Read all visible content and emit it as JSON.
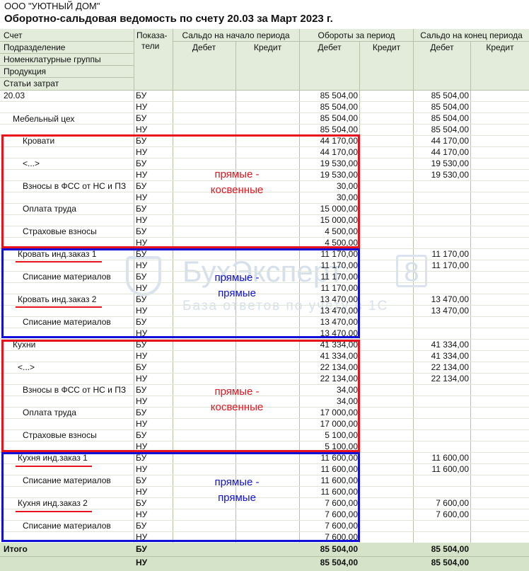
{
  "doc": {
    "org": "ООО \"УЮТНЫЙ ДОМ\"",
    "title": "Оборотно-сальдовая ведомость по счету 20.03 за Март 2023 г."
  },
  "header": {
    "dims": [
      "Счет",
      "Подразделение",
      "Номенклатурные группы",
      "Продукция",
      "Статьи затрат"
    ],
    "indicator_l1": "Показа-",
    "indicator_l2": "тели",
    "groups": [
      "Сальдо на начало периода",
      "Обороты за период",
      "Сальдо на конец периода"
    ],
    "debit": "Дебет",
    "credit": "Кредит"
  },
  "rows": [
    {
      "name": "20.03",
      "ind": "БУ",
      "turn_d": "85 504,00",
      "end_d": "85 504,00"
    },
    {
      "name": "",
      "ind": "НУ",
      "turn_d": "85 504,00",
      "end_d": "85 504,00"
    },
    {
      "name": "Мебельный цех",
      "ind": "БУ",
      "turn_d": "85 504,00",
      "end_d": "85 504,00"
    },
    {
      "name": "",
      "ind": "НУ",
      "turn_d": "85 504,00",
      "end_d": "85 504,00"
    },
    {
      "name": "Кровати",
      "ind": "БУ",
      "turn_d": "44 170,00",
      "end_d": "44 170,00"
    },
    {
      "name": "",
      "ind": "НУ",
      "turn_d": "44 170,00",
      "end_d": "44 170,00"
    },
    {
      "name": "<...>",
      "ind": "БУ",
      "turn_d": "19 530,00",
      "end_d": "19 530,00"
    },
    {
      "name": "",
      "ind": "НУ",
      "turn_d": "19 530,00",
      "end_d": "19 530,00"
    },
    {
      "name": "Взносы в ФСС от НС и ПЗ",
      "ind": "БУ",
      "turn_d": "30,00",
      "end_d": ""
    },
    {
      "name": "",
      "ind": "НУ",
      "turn_d": "30,00",
      "end_d": ""
    },
    {
      "name": "Оплата труда",
      "ind": "БУ",
      "turn_d": "15 000,00",
      "end_d": ""
    },
    {
      "name": "",
      "ind": "НУ",
      "turn_d": "15 000,00",
      "end_d": ""
    },
    {
      "name": "Страховые взносы",
      "ind": "БУ",
      "turn_d": "4 500,00",
      "end_d": ""
    },
    {
      "name": "",
      "ind": "НУ",
      "turn_d": "4 500,00",
      "end_d": ""
    },
    {
      "name": "Кровать инд.заказ 1",
      "ind": "БУ",
      "turn_d": "11 170,00",
      "end_d": "11 170,00"
    },
    {
      "name": "",
      "ind": "НУ",
      "turn_d": "11 170,00",
      "end_d": "11 170,00"
    },
    {
      "name": "Списание материалов",
      "ind": "БУ",
      "turn_d": "11 170,00",
      "end_d": ""
    },
    {
      "name": "",
      "ind": "НУ",
      "turn_d": "11 170,00",
      "end_d": ""
    },
    {
      "name": "Кровать инд.заказ 2",
      "ind": "БУ",
      "turn_d": "13 470,00",
      "end_d": "13 470,00"
    },
    {
      "name": "",
      "ind": "НУ",
      "turn_d": "13 470,00",
      "end_d": "13 470,00"
    },
    {
      "name": "Списание материалов",
      "ind": "БУ",
      "turn_d": "13 470,00",
      "end_d": ""
    },
    {
      "name": "",
      "ind": "НУ",
      "turn_d": "13 470,00",
      "end_d": ""
    },
    {
      "name": "Кухни",
      "ind": "БУ",
      "turn_d": "41 334,00",
      "end_d": "41 334,00"
    },
    {
      "name": "",
      "ind": "НУ",
      "turn_d": "41 334,00",
      "end_d": "41 334,00"
    },
    {
      "name": "<...>",
      "ind": "БУ",
      "turn_d": "22 134,00",
      "end_d": "22 134,00"
    },
    {
      "name": "",
      "ind": "НУ",
      "turn_d": "22 134,00",
      "end_d": "22 134,00"
    },
    {
      "name": "Взносы в ФСС от НС и ПЗ",
      "ind": "БУ",
      "turn_d": "34,00",
      "end_d": ""
    },
    {
      "name": "",
      "ind": "НУ",
      "turn_d": "34,00",
      "end_d": ""
    },
    {
      "name": "Оплата труда",
      "ind": "БУ",
      "turn_d": "17 000,00",
      "end_d": ""
    },
    {
      "name": "",
      "ind": "НУ",
      "turn_d": "17 000,00",
      "end_d": ""
    },
    {
      "name": "Страховые взносы",
      "ind": "БУ",
      "turn_d": "5 100,00",
      "end_d": ""
    },
    {
      "name": "",
      "ind": "НУ",
      "turn_d": "5 100,00",
      "end_d": ""
    },
    {
      "name": "Кухня инд.заказ 1",
      "ind": "БУ",
      "turn_d": "11 600,00",
      "end_d": "11 600,00"
    },
    {
      "name": "",
      "ind": "НУ",
      "turn_d": "11 600,00",
      "end_d": "11 600,00"
    },
    {
      "name": "Списание материалов",
      "ind": "БУ",
      "turn_d": "11 600,00",
      "end_d": ""
    },
    {
      "name": "",
      "ind": "НУ",
      "turn_d": "11 600,00",
      "end_d": ""
    },
    {
      "name": "Кухня инд.заказ 2",
      "ind": "БУ",
      "turn_d": "7 600,00",
      "end_d": "7 600,00"
    },
    {
      "name": "",
      "ind": "НУ",
      "turn_d": "7 600,00",
      "end_d": "7 600,00"
    },
    {
      "name": "Списание материалов",
      "ind": "БУ",
      "turn_d": "7 600,00",
      "end_d": ""
    },
    {
      "name": "",
      "ind": "НУ",
      "turn_d": "7 600,00",
      "end_d": ""
    }
  ],
  "total": {
    "label": "Итого",
    "bu": "БУ",
    "nu": "НУ",
    "turn_d_bu": "85 504,00",
    "end_d_bu": "85 504,00",
    "turn_d_nu": "85 504,00",
    "end_d_nu": "85 504,00"
  },
  "annotations": {
    "red_l1": "прямые -",
    "red_l2": "косвенные",
    "blue_l1": "прямые -",
    "blue_l2": "прямые"
  },
  "watermark": {
    "brand": "БухЭксперт",
    "num": "8",
    "sub": "База ответов по учету в 1С"
  },
  "colors": {
    "header_bg": "#e3ecda",
    "total_bg": "#d5e3c8",
    "red_box": "#e8121c",
    "blue_box": "#1010d8"
  }
}
